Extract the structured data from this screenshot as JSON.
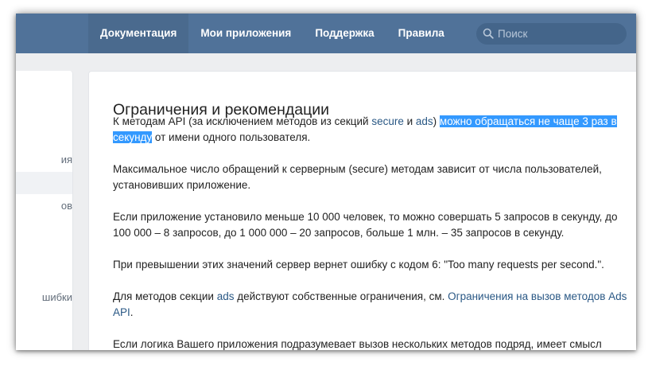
{
  "nav": {
    "items": [
      {
        "label": "Документация",
        "active": true
      },
      {
        "label": "Мои приложения",
        "active": false
      },
      {
        "label": "Поддержка",
        "active": false
      },
      {
        "label": "Правила",
        "active": false
      }
    ]
  },
  "search": {
    "placeholder": "Поиск"
  },
  "sidebar": {
    "items": [
      {
        "label": "ия"
      },
      {
        "label": ""
      },
      {
        "label": "ов"
      },
      {
        "label": "шибки"
      }
    ]
  },
  "content": {
    "title": "Ограничения и рекомендации",
    "p1": {
      "t1": "К методам API (за исключением методов из секций ",
      "link1": "secure",
      "t2": " и ",
      "link2": "ads",
      "t3": ") ",
      "highlight1": "можно обращаться не чаще 3 раз в",
      "highlight2": "секунду",
      "t4": " от имени одного пользователя."
    },
    "p2": "Максимальное число обращений к серверным (secure) методам зависит от числа пользователей, установивших приложение.",
    "p3": "Если приложение установило меньше 10 000 человек, то можно совершать 5 запросов в секунду, до 100 000 – 8 запросов, до 1 000 000 – 20 запросов, больше 1 млн. – 35 запросов в секунду.",
    "p4": "При превышении этих значений сервер вернет ошибку с кодом 6: \"Too many requests per second.\".",
    "p5": {
      "t1": "Для методов секции ",
      "link1": "ads",
      "t2": " действуют собственные ограничения, см. ",
      "link2": "Ограничения на вызов методов Ads API",
      "t3": "."
    },
    "p6": "Если логика Вашего приложения подразумевает вызов нескольких методов подряд, имеет смысл"
  },
  "colors": {
    "header": "#507299",
    "nav_active": "#4a6a8e",
    "search_bg": "#44658a",
    "link": "#2a5885",
    "selection": "#3399ff",
    "page_bg": "#edeef0"
  }
}
